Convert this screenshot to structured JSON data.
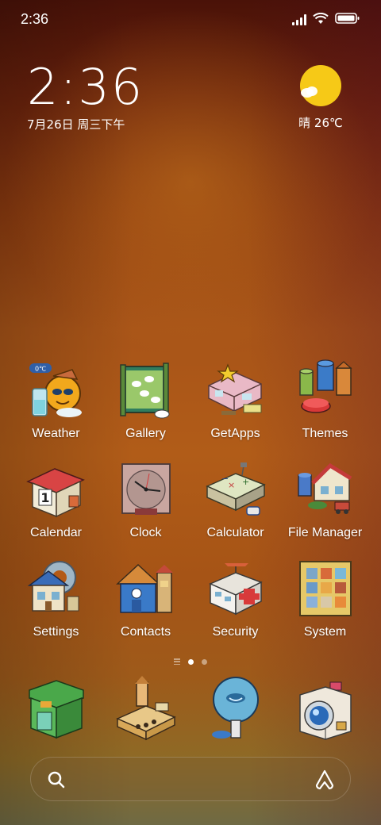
{
  "status_bar": {
    "time": "2:36"
  },
  "clock_widget": {
    "time": "2:36",
    "date": "7月26日 周三下午"
  },
  "weather_widget": {
    "text": "晴 26℃",
    "icon": "sunny-icon"
  },
  "apps": [
    {
      "label": "Weather",
      "icon": "weather-icon"
    },
    {
      "label": "Gallery",
      "icon": "gallery-icon"
    },
    {
      "label": "GetApps",
      "icon": "getapps-icon"
    },
    {
      "label": "Themes",
      "icon": "themes-icon"
    },
    {
      "label": "Calendar",
      "icon": "calendar-icon"
    },
    {
      "label": "Clock",
      "icon": "clock-icon"
    },
    {
      "label": "Calculator",
      "icon": "calculator-icon"
    },
    {
      "label": "File Manager",
      "icon": "file-manager-icon"
    },
    {
      "label": "Settings",
      "icon": "settings-icon"
    },
    {
      "label": "Contacts",
      "icon": "contacts-icon"
    },
    {
      "label": "Security",
      "icon": "security-icon"
    },
    {
      "label": "System",
      "icon": "system-folder-icon"
    }
  ],
  "calendar_day": "1",
  "weather_badge": "0℃",
  "dock": [
    {
      "icon": "phone-icon"
    },
    {
      "icon": "messages-icon"
    },
    {
      "icon": "browser-icon"
    },
    {
      "icon": "camera-icon"
    }
  ],
  "search": {
    "placeholder": "",
    "icon": "search-icon",
    "assistant_icon": "assistant-icon"
  },
  "page_indicator": {
    "pages": 2,
    "current": 1
  }
}
